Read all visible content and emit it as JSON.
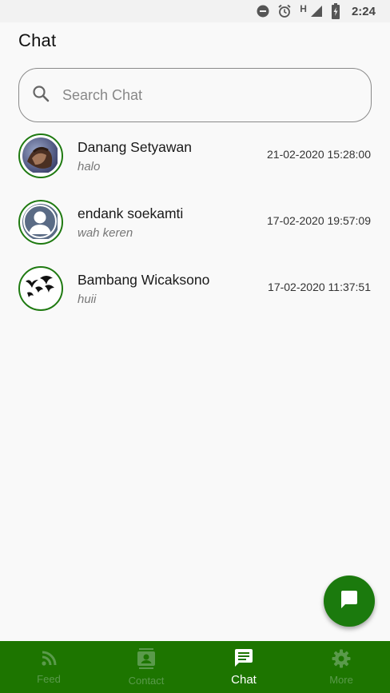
{
  "status_bar": {
    "network_label": "H",
    "time": "2:24"
  },
  "header": {
    "title": "Chat"
  },
  "search": {
    "placeholder": "Search Chat",
    "value": ""
  },
  "chats": [
    {
      "name": "Danang Setyawan",
      "last_message": "halo",
      "timestamp": "21-02-2020 15:28:00",
      "avatar": "photo"
    },
    {
      "name": "endank soekamti",
      "last_message": "wah keren",
      "timestamp": "17-02-2020 19:57:09",
      "avatar": "default-person"
    },
    {
      "name": "Bambang Wicaksono",
      "last_message": "huii",
      "timestamp": "17-02-2020 11:37:51",
      "avatar": "birds"
    }
  ],
  "fab": {
    "icon": "chat-bubble-icon"
  },
  "bottom_nav": {
    "tabs": [
      {
        "label": "Feed",
        "icon": "rss-feed-icon",
        "active": false
      },
      {
        "label": "Contact",
        "icon": "contact-card-icon",
        "active": false
      },
      {
        "label": "Chat",
        "icon": "chat-icon",
        "active": true
      },
      {
        "label": "More",
        "icon": "gear-icon",
        "active": false
      }
    ]
  },
  "colors": {
    "accent": "#1d7500",
    "fab": "#1b7a0d",
    "avatar_ring": "#1f7a11",
    "inactive_tab": "#5a9a4b"
  }
}
